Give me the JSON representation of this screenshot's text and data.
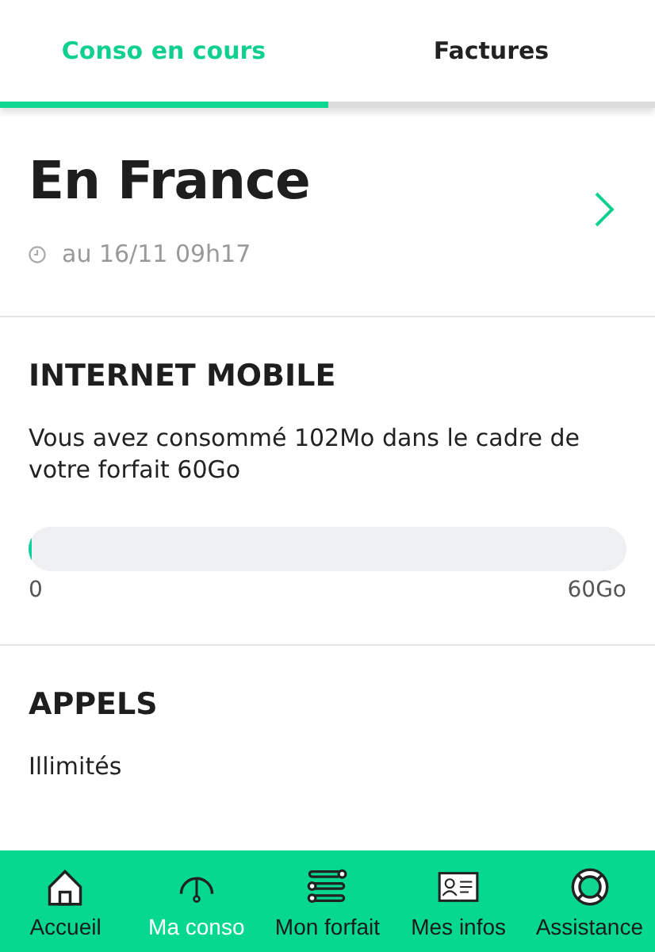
{
  "tabs": [
    {
      "label": "Conso en cours",
      "selected": true
    },
    {
      "label": "Factures",
      "selected": false
    }
  ],
  "summary": {
    "title": "En France",
    "updated": "au 16/11 09h17"
  },
  "sections": [
    {
      "kind": "meter",
      "title": "INTERNET MOBILE",
      "text": "Vous avez consommé 102Mo dans le cadre de votre forfait 60Go",
      "level": 0.005,
      "min_label": "0",
      "max_label": "60Go"
    },
    {
      "kind": "plain",
      "title": "APPELS",
      "text": "Illimités"
    }
  ],
  "nav": [
    {
      "label": "Accueil",
      "selected": false
    },
    {
      "label": "Ma conso",
      "selected": true
    },
    {
      "label": "Mon forfait",
      "selected": false
    },
    {
      "label": "Mes infos",
      "selected": false
    },
    {
      "label": "Assistance",
      "selected": false
    }
  ]
}
